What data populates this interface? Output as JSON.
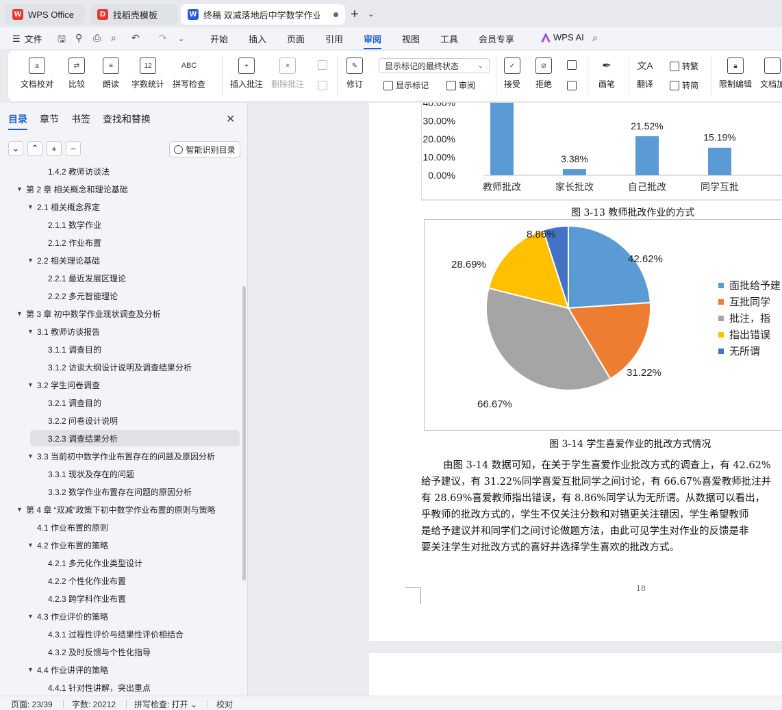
{
  "tabs": [
    {
      "label": "WPS Office",
      "icon": "W",
      "color": "#e53935"
    },
    {
      "label": "找稻壳模板",
      "icon": "D",
      "color": "#e53935"
    },
    {
      "label": "终稿 双减落地后中学数学作业",
      "icon": "W",
      "color": "#2b5bd7"
    }
  ],
  "menu": {
    "file": "文件",
    "items": [
      "开始",
      "插入",
      "页面",
      "引用",
      "审阅",
      "视图",
      "工具",
      "会员专享"
    ],
    "active": "审阅",
    "ai": "WPS AI"
  },
  "ribbon": {
    "doc_check": "文档校对",
    "compare": "比较",
    "read_aloud": "朗读",
    "word_count": "字数统计",
    "word_count_glyph": "12",
    "spell_check": "拼写检查",
    "spell_glyph": "ABC",
    "insert_comment": "插入批注",
    "delete_comment": "删除批注",
    "revise": "修订",
    "markup_state": "显示标记的最终状态",
    "show_markup": "显示标记",
    "review_pane": "审阅",
    "accept": "接受",
    "reject": "拒绝",
    "pen": "画笔",
    "translate": "翻译",
    "to_traditional": "转繁",
    "to_simplified": "转简",
    "restrict_edit": "限制编辑",
    "doc_encrypt": "文档加"
  },
  "nav": {
    "tabs": [
      "目录",
      "章节",
      "书签",
      "查找和替换"
    ],
    "active_tab": "目录",
    "smart_toc": "智能识别目录",
    "toc": [
      {
        "level": 3,
        "text": "1.4.2  教师访谈法",
        "arrow": ""
      },
      {
        "level": 1,
        "text": "第 2 章  相关概念和理论基础",
        "arrow": "▼"
      },
      {
        "level": 2,
        "text": "2.1  相关概念界定",
        "arrow": "▼"
      },
      {
        "level": 3,
        "text": "2.1.1  数学作业",
        "arrow": ""
      },
      {
        "level": 3,
        "text": "2.1.2  作业布置",
        "arrow": ""
      },
      {
        "level": 2,
        "text": "2.2  相关理论基础",
        "arrow": "▼"
      },
      {
        "level": 3,
        "text": "2.2.1  最近发展区理论",
        "arrow": ""
      },
      {
        "level": 3,
        "text": "2.2.2  多元智能理论",
        "arrow": ""
      },
      {
        "level": 1,
        "text": "第 3 章  初中数学作业现状调查及分析",
        "arrow": "▼"
      },
      {
        "level": 2,
        "text": "3.1 教师访谈报告",
        "arrow": "▼"
      },
      {
        "level": 3,
        "text": "3.1.1 调查目的",
        "arrow": ""
      },
      {
        "level": 3,
        "text": "3.1.2 访谈大纲设计说明及调查结果分析",
        "arrow": ""
      },
      {
        "level": 2,
        "text": "3.2 学生问卷调查",
        "arrow": "▼"
      },
      {
        "level": 3,
        "text": "3.2.1 调查目的",
        "arrow": ""
      },
      {
        "level": 3,
        "text": "3.2.2 问卷设计说明",
        "arrow": ""
      },
      {
        "level": 3,
        "text": "3.2.3 调查结果分析",
        "arrow": "",
        "selected": true
      },
      {
        "level": 2,
        "text": "3.3 当前初中数学作业布置存在的问题及原因分析",
        "arrow": "▼"
      },
      {
        "level": 3,
        "text": "3.3.1 现状及存在的问题",
        "arrow": ""
      },
      {
        "level": 3,
        "text": "3.3.2 数学作业布置存在问题的原因分析",
        "arrow": ""
      },
      {
        "level": 1,
        "text": "第 4 章  “双减”政策下初中数学作业布置的原则与策略",
        "arrow": "▼"
      },
      {
        "level": 2,
        "text": "4.1  作业布置的原则",
        "arrow": ""
      },
      {
        "level": 2,
        "text": "4.2  作业布置的策略",
        "arrow": "▼"
      },
      {
        "level": 3,
        "text": "4.2.1 多元化作业类型设计",
        "arrow": ""
      },
      {
        "level": 3,
        "text": "4.2.2 个性化作业布置",
        "arrow": ""
      },
      {
        "level": 3,
        "text": "4.2.3 跨学科作业布置",
        "arrow": ""
      },
      {
        "level": 2,
        "text": "4.3  作业评价的策略",
        "arrow": "▼"
      },
      {
        "level": 3,
        "text": "4.3.1 过程性评价与结果性评价相结合",
        "arrow": ""
      },
      {
        "level": 3,
        "text": "4.3.2 及时反馈与个性化指导",
        "arrow": ""
      },
      {
        "level": 2,
        "text": "4.4  作业讲评的策略",
        "arrow": "▼"
      },
      {
        "level": 3,
        "text": "4.4.1 针对性讲解，突出重点",
        "arrow": ""
      }
    ]
  },
  "document": {
    "caption_13": "图 3-13  教师批改作业的方式",
    "caption_14": "图 3-14  学生喜爱作业的批改方式情况",
    "paragraph": [
      "由图 3-14 数据可知，在关于学生喜爱作业批改方式的调查上，有 42.62%",
      "给予建议，有 31.22%同学喜爱互批同学之间讨论，有 66.67%喜爱教师批注并",
      "有  28.69%喜爱教师指出错误，有 8.86%同学认为无所谓。从数据可以看出，",
      "乎教师的批改方式的，学生不仅关注分数和对错更关注错因，学生希望教师",
      "是给予建议并和同学们之间讨论做题方法，由此可见学生对作业的反馈是非",
      "要关注学生对批改方式的喜好并选择学生喜欢的批改方式。"
    ],
    "page_number": "18"
  },
  "chart_data": [
    {
      "type": "bar",
      "categories": [
        "教师批改",
        "家长批改",
        "自己批改",
        "同学互批"
      ],
      "values": [
        59.91,
        3.38,
        21.52,
        15.19
      ],
      "labels": [
        "",
        "3.38%",
        "21.52%",
        "15.19%"
      ],
      "yticks": [
        "0.00%",
        "10.00%",
        "20.00%",
        "30.00%",
        "40.00%"
      ],
      "ylim": [
        0,
        40
      ],
      "color": "#5b9bd5"
    },
    {
      "type": "pie",
      "slices": [
        {
          "name": "面批给予建议",
          "legend": "面批给予建",
          "value": 42.62,
          "label": "42.62%",
          "color": "#5b9bd5"
        },
        {
          "name": "互批同学之间讨论",
          "legend": "互批同学",
          "value": 31.22,
          "label": "31.22%",
          "color": "#ed7d31"
        },
        {
          "name": "批注，指出错误",
          "legend": "批注，指",
          "value": 66.67,
          "label": "66.67%",
          "color": "#a5a5a5"
        },
        {
          "name": "指出错误",
          "legend": "指出错误",
          "value": 28.69,
          "label": "28.69%",
          "color": "#ffc000"
        },
        {
          "name": "无所谓",
          "legend": "无所谓",
          "value": 8.86,
          "label": "8.86%",
          "color": "#4472c4"
        }
      ]
    }
  ],
  "status": {
    "page": "页面: 23/39",
    "words": "字数: 20212",
    "spell": "拼写检查: 打开",
    "proof": "校对"
  }
}
